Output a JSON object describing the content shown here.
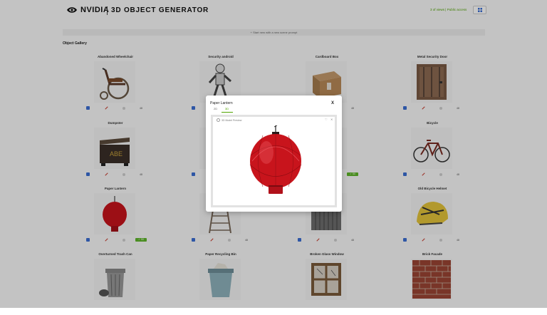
{
  "header": {
    "brand": "NVIDIA",
    "title": "3D OBJECT GENERATOR",
    "links": [
      "3 of views",
      "Public access"
    ]
  },
  "banner": {
    "text": "+ Start new with a new scene prompt"
  },
  "gallery": {
    "title": "Object Gallery",
    "cards": [
      {
        "name": "Abandoned Wheelchair",
        "icon": "wheelchair",
        "count": "48",
        "status": ""
      },
      {
        "name": "Security android",
        "icon": "android",
        "count": "",
        "status": ""
      },
      {
        "name": "Cardboard Box",
        "icon": "cardboard-box",
        "count": "48",
        "status": ""
      },
      {
        "name": "Metal Security Door",
        "icon": "metal-door",
        "count": "48",
        "status": ""
      },
      {
        "name": "Dumpster",
        "icon": "dumpster",
        "count": "48",
        "status": ""
      },
      {
        "name": "",
        "icon": "",
        "count": "",
        "status": ""
      },
      {
        "name": "",
        "icon": "",
        "count": "",
        "status": "✓ 50"
      },
      {
        "name": "Bicycle",
        "icon": "bicycle",
        "count": "48",
        "status": ""
      },
      {
        "name": "Paper Lantern",
        "icon": "paper-lantern",
        "count": "",
        "status": "✓ 50"
      },
      {
        "name": "",
        "icon": "ladder",
        "count": "48",
        "status": ""
      },
      {
        "name": "",
        "icon": "fence",
        "count": "48",
        "status": ""
      },
      {
        "name": "Old Bicycle Helmet",
        "icon": "helmet",
        "count": "48",
        "status": ""
      },
      {
        "name": "Overturned Trash Can",
        "icon": "trash-can",
        "count": "",
        "status": ""
      },
      {
        "name": "Paper Recycling Bin",
        "icon": "recycling-bin",
        "count": "",
        "status": ""
      },
      {
        "name": "Broken Glass Window",
        "icon": "window",
        "count": "",
        "status": ""
      },
      {
        "name": "Brick Facade",
        "icon": "brick-wall",
        "count": "",
        "status": ""
      }
    ]
  },
  "modal": {
    "title": "Paper Lantern",
    "close": "X",
    "tabs": [
      "2D",
      "3D"
    ],
    "viewer_label": "3D Model Preview",
    "controls": [
      "♡",
      "✕"
    ]
  },
  "colors": {
    "accent_green": "#4fa400",
    "action_blue": "#3b6fd4",
    "lantern_red": "#c8141c"
  }
}
